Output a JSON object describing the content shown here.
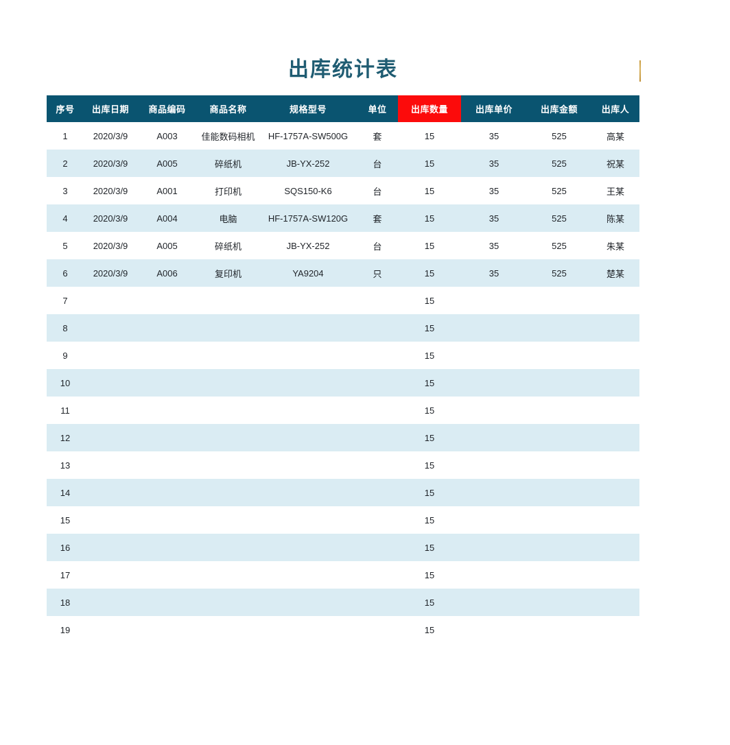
{
  "document": {
    "title": "出库统计表",
    "accent_header_color": "#0a5470",
    "highlight_color": "#fc0b0b",
    "stripe_color": "#daecf3",
    "title_color": "#1f5c72",
    "marker_color": "#c79a3e"
  },
  "table": {
    "columns": [
      {
        "key": "idx",
        "label": "序号",
        "highlighted": false
      },
      {
        "key": "date",
        "label": "出库日期",
        "highlighted": false
      },
      {
        "key": "code",
        "label": "商品编码",
        "highlighted": false
      },
      {
        "key": "name",
        "label": "商品名称",
        "highlighted": false
      },
      {
        "key": "spec",
        "label": "规格型号",
        "highlighted": false
      },
      {
        "key": "unit",
        "label": "单位",
        "highlighted": false
      },
      {
        "key": "qty",
        "label": "出库数量",
        "highlighted": true
      },
      {
        "key": "price",
        "label": "出库单价",
        "highlighted": false
      },
      {
        "key": "amount",
        "label": "出库金额",
        "highlighted": false
      },
      {
        "key": "person",
        "label": "出库人",
        "highlighted": false
      }
    ],
    "rows": [
      {
        "idx": "1",
        "date": "2020/3/9",
        "code": "A003",
        "name": "佳能数码相机",
        "spec": "HF-1757A-SW500G",
        "unit": "套",
        "qty": "15",
        "price": "35",
        "amount": "525",
        "person": "高某"
      },
      {
        "idx": "2",
        "date": "2020/3/9",
        "code": "A005",
        "name": "碎纸机",
        "spec": "JB-YX-252",
        "unit": "台",
        "qty": "15",
        "price": "35",
        "amount": "525",
        "person": "祝某"
      },
      {
        "idx": "3",
        "date": "2020/3/9",
        "code": "A001",
        "name": "打印机",
        "spec": "SQS150-K6",
        "unit": "台",
        "qty": "15",
        "price": "35",
        "amount": "525",
        "person": "王某"
      },
      {
        "idx": "4",
        "date": "2020/3/9",
        "code": "A004",
        "name": "电脑",
        "spec": "HF-1757A-SW120G",
        "unit": "套",
        "qty": "15",
        "price": "35",
        "amount": "525",
        "person": "陈某"
      },
      {
        "idx": "5",
        "date": "2020/3/9",
        "code": "A005",
        "name": "碎纸机",
        "spec": "JB-YX-252",
        "unit": "台",
        "qty": "15",
        "price": "35",
        "amount": "525",
        "person": "朱某"
      },
      {
        "idx": "6",
        "date": "2020/3/9",
        "code": "A006",
        "name": "复印机",
        "spec": "YA9204",
        "unit": "只",
        "qty": "15",
        "price": "35",
        "amount": "525",
        "person": "楚某"
      },
      {
        "idx": "7",
        "date": "",
        "code": "",
        "name": "",
        "spec": "",
        "unit": "",
        "qty": "15",
        "price": "",
        "amount": "",
        "person": ""
      },
      {
        "idx": "8",
        "date": "",
        "code": "",
        "name": "",
        "spec": "",
        "unit": "",
        "qty": "15",
        "price": "",
        "amount": "",
        "person": ""
      },
      {
        "idx": "9",
        "date": "",
        "code": "",
        "name": "",
        "spec": "",
        "unit": "",
        "qty": "15",
        "price": "",
        "amount": "",
        "person": ""
      },
      {
        "idx": "10",
        "date": "",
        "code": "",
        "name": "",
        "spec": "",
        "unit": "",
        "qty": "15",
        "price": "",
        "amount": "",
        "person": ""
      },
      {
        "idx": "11",
        "date": "",
        "code": "",
        "name": "",
        "spec": "",
        "unit": "",
        "qty": "15",
        "price": "",
        "amount": "",
        "person": ""
      },
      {
        "idx": "12",
        "date": "",
        "code": "",
        "name": "",
        "spec": "",
        "unit": "",
        "qty": "15",
        "price": "",
        "amount": "",
        "person": ""
      },
      {
        "idx": "13",
        "date": "",
        "code": "",
        "name": "",
        "spec": "",
        "unit": "",
        "qty": "15",
        "price": "",
        "amount": "",
        "person": ""
      },
      {
        "idx": "14",
        "date": "",
        "code": "",
        "name": "",
        "spec": "",
        "unit": "",
        "qty": "15",
        "price": "",
        "amount": "",
        "person": ""
      },
      {
        "idx": "15",
        "date": "",
        "code": "",
        "name": "",
        "spec": "",
        "unit": "",
        "qty": "15",
        "price": "",
        "amount": "",
        "person": ""
      },
      {
        "idx": "16",
        "date": "",
        "code": "",
        "name": "",
        "spec": "",
        "unit": "",
        "qty": "15",
        "price": "",
        "amount": "",
        "person": ""
      },
      {
        "idx": "17",
        "date": "",
        "code": "",
        "name": "",
        "spec": "",
        "unit": "",
        "qty": "15",
        "price": "",
        "amount": "",
        "person": ""
      },
      {
        "idx": "18",
        "date": "",
        "code": "",
        "name": "",
        "spec": "",
        "unit": "",
        "qty": "15",
        "price": "",
        "amount": "",
        "person": ""
      },
      {
        "idx": "19",
        "date": "",
        "code": "",
        "name": "",
        "spec": "",
        "unit": "",
        "qty": "15",
        "price": "",
        "amount": "",
        "person": ""
      }
    ]
  }
}
